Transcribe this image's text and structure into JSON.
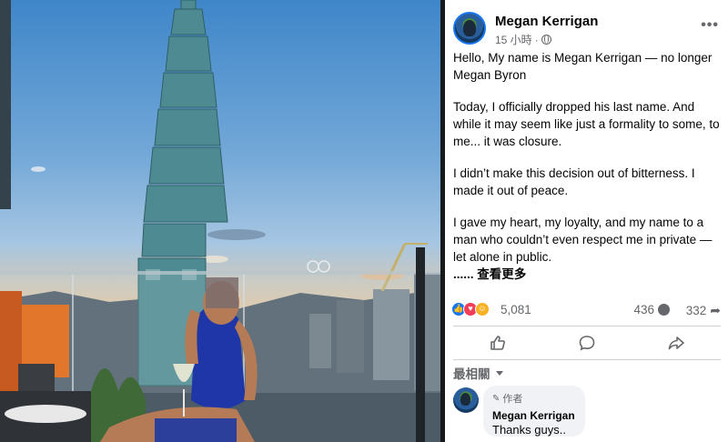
{
  "post": {
    "author": "Megan Kerrigan",
    "time": "15 小時",
    "more_icon": "more-options-icon",
    "paragraphs": [
      "Hello, My name is Megan Kerrigan — no longer Megan Byron",
      "Today, I officially dropped his last name. And while it may seem like just a formality to some, to me... it was closure.",
      "I didn’t make this decision out of bitterness. I made it out of peace.",
      "I gave my heart, my loyalty, and my name to a man who couldn’t even respect me in private — let alone in public."
    ],
    "see_more": "...... 查看更多"
  },
  "stats": {
    "reactions": "5,081",
    "comments": "436",
    "shares": "332"
  },
  "actions": {
    "like_icon": "thumbs-up-icon",
    "comment_icon": "speech-bubble-icon",
    "share_icon": "share-arrow-icon"
  },
  "filter": {
    "label": "最相關"
  },
  "comment": {
    "badge": "作者",
    "name": "Megan Kerrigan",
    "text": "Thanks guys.."
  },
  "colors": {
    "accent": "#1877f2",
    "love": "#f33e58",
    "care": "#f7b125",
    "muted": "#65676b"
  }
}
